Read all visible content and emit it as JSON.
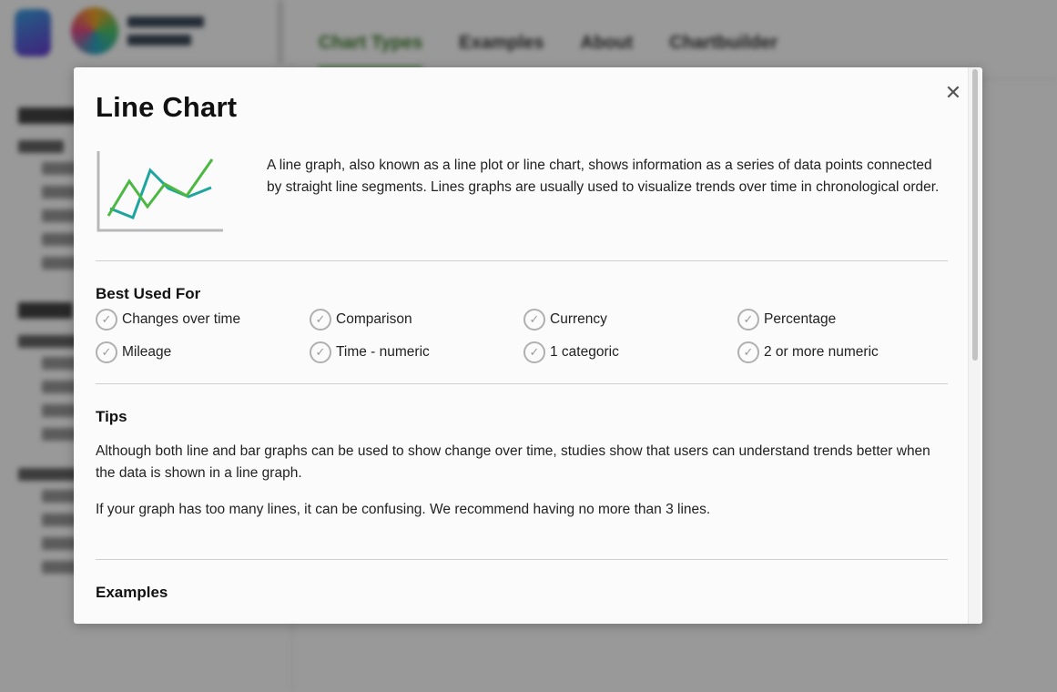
{
  "background": {
    "nav_tabs": [
      "Chart Types",
      "Examples",
      "About",
      "Chartbuilder"
    ]
  },
  "modal": {
    "title": "Line Chart",
    "close_icon": "close-icon",
    "chart_icon": "line-chart-icon",
    "description": "A line graph, also known as a line plot or line chart, shows information as a series of data points connected by straight line segments. Lines graphs are usually used to visualize trends over time in chronological order.",
    "best_used_for": {
      "heading": "Best Used For",
      "items": [
        "Changes over time",
        "Comparison",
        "Currency",
        "Percentage",
        "Mileage",
        "Time - numeric",
        "1 categoric",
        "2 or more numeric"
      ]
    },
    "tips": {
      "heading": "Tips",
      "paragraphs": [
        "Although both line and bar graphs can be used to show change over time, studies show that users can understand trends better when the data is shown in a line graph.",
        "If your graph has too many lines, it can be confusing. We recommend having no more than 3 lines."
      ]
    },
    "examples": {
      "heading": "Examples"
    }
  },
  "colors": {
    "green_line": "#4cb842",
    "teal_line": "#1fa5a0",
    "axis": "#b8b8b8"
  }
}
